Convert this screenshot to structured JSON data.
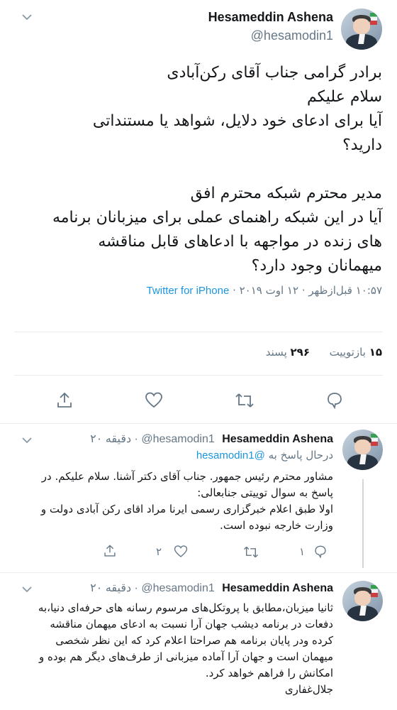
{
  "main_tweet": {
    "author_name": "Hesameddin Ashena",
    "author_handle": "@hesamodin1",
    "lines": [
      "برادر گرامی جناب آقای رکن‌آبادی",
      "سلام علیکم",
      "آیا برای ادعای خود دلایل، شواهد یا مستنداتی",
      "دارید؟",
      "",
      "مدیر محترم شبکه محترم افق",
      "آیا در این شبکه راهنمای عملی برای میزبانان برنامه",
      "های زنده در مواجهه با ادعاهای قابل مناقشه",
      "میهمانان وجود دارد؟"
    ],
    "meta_time": "۱۰:۵۷ قبل‌ازظهر · ۱۲ اوت ۲۰۱۹ · ",
    "meta_source": "Twitter for iPhone",
    "retweets_count": "۱۵",
    "retweets_label": "بازتوییت",
    "likes_count": "۲۹۶",
    "likes_label": "پسند"
  },
  "reply1": {
    "author_name": "Hesameddin Ashena",
    "author_handle": "@hesamodin1",
    "time": "۲۰ دقیقه",
    "reply_prefix": "درحال پاسخ به ",
    "reply_to": "@hesamodin1",
    "lines": [
      "مشاور محترم رئیس جمهور. جناب آقای دکتر آشنا. سلام علیکم. در",
      "پاسخ به سوال توییتی جنابعالی:",
      "اولا طبق اعلام خبرگزاری رسمی ایرنا مراد اقای رکن آبادی دولت و",
      "وزارت خارجه نبوده است."
    ],
    "reply_count": "۱",
    "retweet_count": "۲"
  },
  "reply2": {
    "author_name": "Hesameddin Ashena",
    "author_handle": "@hesamodin1",
    "time": "۲۰ دقیقه",
    "lines": [
      "ثانیا میزبان،مطابق با پروتکل‌های مرسوم رسانه های حرفه‌ای دنیا،به",
      "دفعات در برنامه دیشب جهان آرا نسبت به ادعای میهمان مناقشه",
      "کرده ودر پایان برنامه هم صراحتا اعلام کرد که این نظر شخصی",
      "میهمان است و جهان آرا آماده میزبانی از طرف‌های دیگر هم بوده و",
      "امکانش را فراهم خواهد کرد.",
      "جلال‌غفاری"
    ]
  }
}
